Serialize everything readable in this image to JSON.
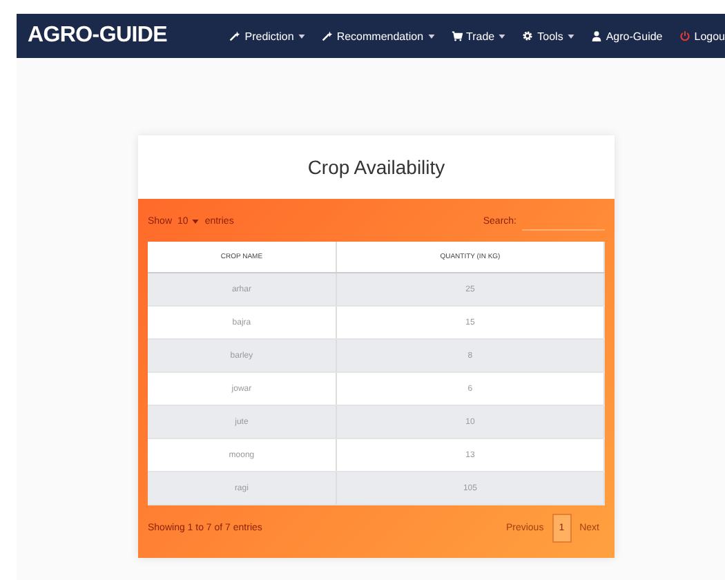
{
  "navbar": {
    "brand": "AGRO-GUIDE",
    "items": [
      {
        "label": "Prediction",
        "kind": "wand",
        "dropdown": true
      },
      {
        "label": "Recommendation",
        "kind": "wand",
        "dropdown": true
      },
      {
        "label": "Trade",
        "kind": "cart",
        "dropdown": true
      },
      {
        "label": "Tools",
        "kind": "gear",
        "dropdown": true
      },
      {
        "label": "Agro-Guide",
        "kind": "user",
        "dropdown": false
      },
      {
        "label": "Logou",
        "kind": "power",
        "dropdown": false
      }
    ]
  },
  "card": {
    "title": "Crop Availability",
    "length_label_before": "Show",
    "length_value": "10",
    "length_label_after": "entries",
    "search_label": "Search:",
    "columns": [
      "CROP NAME",
      "QUANTITY (IN KG)"
    ],
    "rows": [
      [
        "arhar",
        "25"
      ],
      [
        "bajra",
        "15"
      ],
      [
        "barley",
        "8"
      ],
      [
        "jowar",
        "6"
      ],
      [
        "jute",
        "10"
      ],
      [
        "moong",
        "13"
      ],
      [
        "ragi",
        "105"
      ]
    ],
    "info": "Showing 1 to 7 of 7 entries",
    "pagination": [
      {
        "label": "Previous",
        "selected": false
      },
      {
        "label": "1",
        "selected": true
      },
      {
        "label": "Next",
        "selected": false
      }
    ]
  }
}
